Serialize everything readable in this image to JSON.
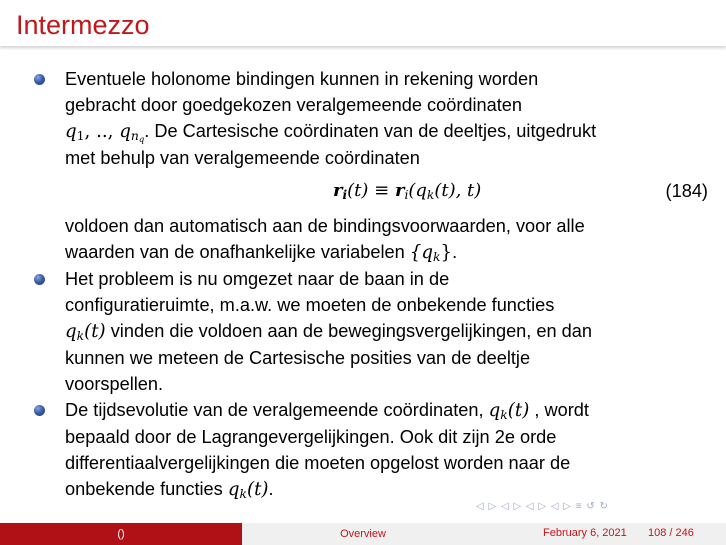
{
  "slide": {
    "title": "Intermezzo"
  },
  "footer": {
    "author": "()",
    "section": "Overview",
    "date": "February 6, 2021",
    "page": "108 / 246"
  },
  "nav_symbols": "◁ ▷ ◁ ▷ ◁ ▷ ◁ ▷ ≡ ↺ ↻",
  "colors": {
    "title": "#c0171b",
    "footer_left_bg": "#b01116",
    "bullet": "#3a5fa6"
  },
  "content": {
    "bullet1": {
      "l1": "Eventuele holonome bindingen kunnen in rekening worden",
      "l2": "gebracht door goedgekozen veralgemeende coördinaten",
      "l3_q": "q",
      "l3_sub1": "1",
      "l3_sep": ", .., ",
      "l3_q2": "q",
      "l3_sub2": "n",
      "l3_sub2b": "q",
      "l3_rest": ". De Cartesische coördinaten van de deeltjes, uitgedrukt",
      "l4": "met behulp van veralgemeende coördinaten",
      "eq_left_r": "r",
      "eq_left_i": "i",
      "eq_left_t": "(t) ≡ ",
      "eq_right_r": "r",
      "eq_right_i": "i",
      "eq_right_rest": "(q",
      "eq_right_k": "k",
      "eq_right_end": "(t), t)",
      "eq_number": "(184)",
      "l5": "voldoen dan automatisch aan de bindingsvoorwaarden, voor alle",
      "l6a": "waarden van de onafhankelijke variabelen ",
      "l6_math": "{q",
      "l6_k": "k",
      "l6_close": "}",
      "l6b": "."
    },
    "bullet2": {
      "l1": "Het probleem is nu omgezet naar de baan in de",
      "l2": "configuratieruimte, m.a.w. we moeten de onbekende functies",
      "l3_q": "q",
      "l3_k": "k",
      "l3_t": "(t)",
      "l3_rest": " vinden die voldoen aan de bewegingsvergelijkingen, en dan",
      "l4": "kunnen we meteen de Cartesische posities van de deeltje",
      "l5": "voorspellen."
    },
    "bullet3": {
      "l1a": "De tijdsevolutie van de veralgemeende coördinaten, ",
      "l1_q": "q",
      "l1_k": "k",
      "l1_t": "(t)",
      "l1b": " , wordt",
      "l2": "bepaald door de Lagrangevergelijkingen. Ook dit zijn 2e orde",
      "l3": "differentiaalvergelijkingen die moeten opgelost worden naar de",
      "l4a": "onbekende functies ",
      "l4_q": "q",
      "l4_k": "k",
      "l4_t": "(t)",
      "l4b": "."
    }
  }
}
